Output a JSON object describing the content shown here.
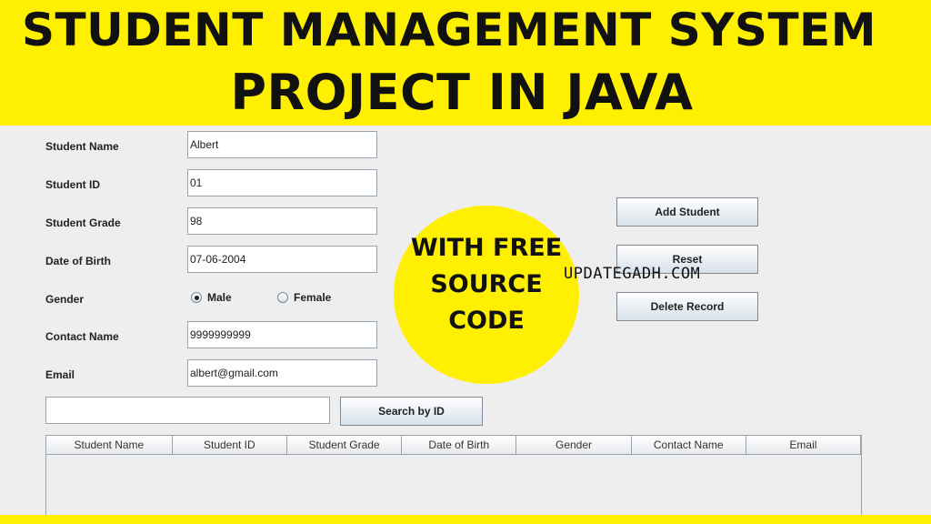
{
  "banner": {
    "line1": "STUDENT MANAGEMENT SYSTEM",
    "line2": "PROJECT IN JAVA"
  },
  "promo": {
    "circle_text": "WITH FREE SOURCE CODE",
    "site": "UPDATEGADH.COM"
  },
  "form": {
    "student_name_label": "Student Name",
    "student_name_value": "Albert",
    "student_id_label": "Student ID",
    "student_id_value": "01",
    "student_grade_label": "Student Grade",
    "student_grade_value": "98",
    "dob_label": "Date of Birth",
    "dob_value": "07-06-2004",
    "gender_label": "Gender",
    "gender_male": "Male",
    "gender_female": "Female",
    "gender_selected": "Male",
    "contact_label": "Contact Name",
    "contact_value": "9999999999",
    "email_label": "Email",
    "email_value": "albert@gmail.com"
  },
  "buttons": {
    "add": "Add Student",
    "reset": "Reset",
    "delete": "Delete Record",
    "search": "Search by ID"
  },
  "search": {
    "value": ""
  },
  "table": {
    "columns": [
      "Student Name",
      "Student ID",
      "Student Grade",
      "Date of Birth",
      "Gender",
      "Contact Name",
      "Email"
    ]
  },
  "colors": {
    "banner": "#ffef00",
    "panel": "#eeeeee"
  }
}
